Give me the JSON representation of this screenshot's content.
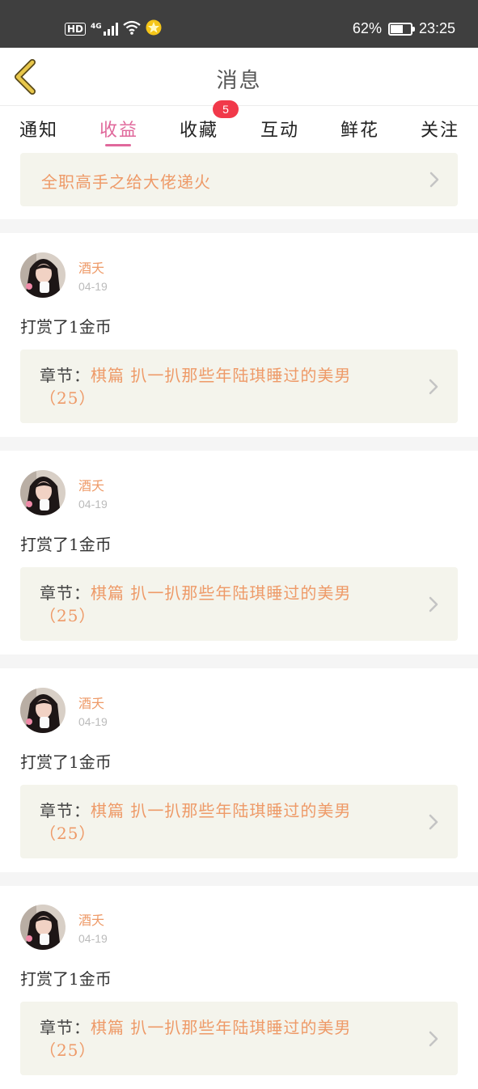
{
  "status_bar": {
    "network_hd": "HD",
    "network_type": "4G",
    "battery_percent": "62%",
    "battery_level": 0.62,
    "time": "23:25"
  },
  "header": {
    "title": "消息",
    "back_icon": "chevron-left-icon"
  },
  "tabs": [
    {
      "label": "通知",
      "active": false
    },
    {
      "label": "收益",
      "active": true
    },
    {
      "label": "收藏",
      "active": false,
      "badge": "5"
    },
    {
      "label": "互动",
      "active": false
    },
    {
      "label": "鲜花",
      "active": false
    },
    {
      "label": "关注",
      "active": false
    }
  ],
  "banner": {
    "text": "全职高手之给大佬递火"
  },
  "items": [
    {
      "name": "酒夭",
      "date": "04-19",
      "action": "打赏了1金币",
      "chapter_label": "章节：",
      "chapter_title": "棋篇 扒一扒那些年陆琪睡过的美男（25）"
    },
    {
      "name": "酒夭",
      "date": "04-19",
      "action": "打赏了1金币",
      "chapter_label": "章节：",
      "chapter_title": "棋篇 扒一扒那些年陆琪睡过的美男（25）"
    },
    {
      "name": "酒夭",
      "date": "04-19",
      "action": "打赏了1金币",
      "chapter_label": "章节：",
      "chapter_title": "棋篇 扒一扒那些年陆琪睡过的美男（25）"
    },
    {
      "name": "酒夭",
      "date": "04-19",
      "action": "打赏了1金币",
      "chapter_label": "章节：",
      "chapter_title": "棋篇 扒一扒那些年陆琪睡过的美男（25）"
    }
  ],
  "colors": {
    "accent_pink": "#e0689b",
    "accent_orange": "#ee9a68",
    "badge_red": "#f1394a",
    "back_yellow": "#e8c74a"
  }
}
